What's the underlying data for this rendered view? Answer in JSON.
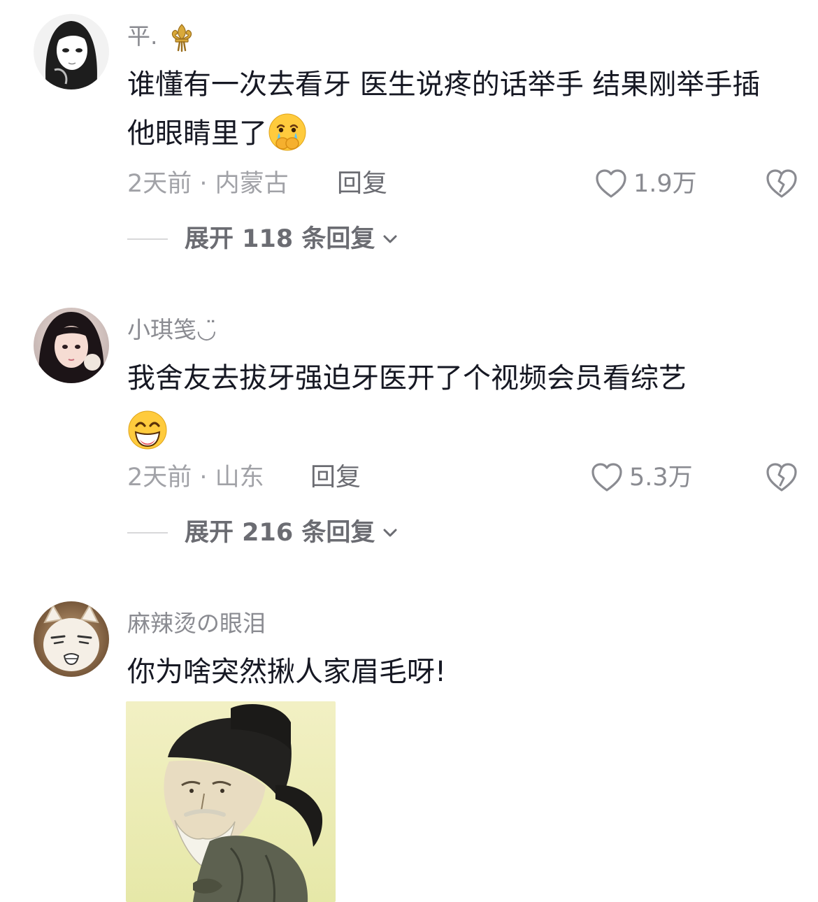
{
  "comments": [
    {
      "username": "平.",
      "username_badge_icon": "fleur-de-lis-icon",
      "text": "谁懂有一次去看牙 医生说疼的话举手 结果刚举手插他眼睛里了",
      "emoji": "crying-covering-mouth-emoji",
      "time_location": "2天前 · 内蒙古",
      "reply_label": "回复",
      "like_count": "1.9万",
      "expand_label": "展开 118 条回复"
    },
    {
      "username": "小琪笺◡̈",
      "text": "我舍友去拔牙强迫牙医开了个视频会员看综艺",
      "emoji": "grinning-squinting-emoji",
      "time_location": "2天前 · 山东",
      "reply_label": "回复",
      "like_count": "5.3万",
      "expand_label": "展开 216 条回复"
    },
    {
      "username": "麻辣烫の眼泪",
      "text": "你为啥突然揪人家眉毛呀!",
      "sticker": "ancient-scholar-sticker"
    }
  ],
  "colors": {
    "text_primary": "#161823",
    "text_secondary": "#8a8b91",
    "text_tertiary": "#a1a2a7",
    "background": "#ffffff"
  }
}
